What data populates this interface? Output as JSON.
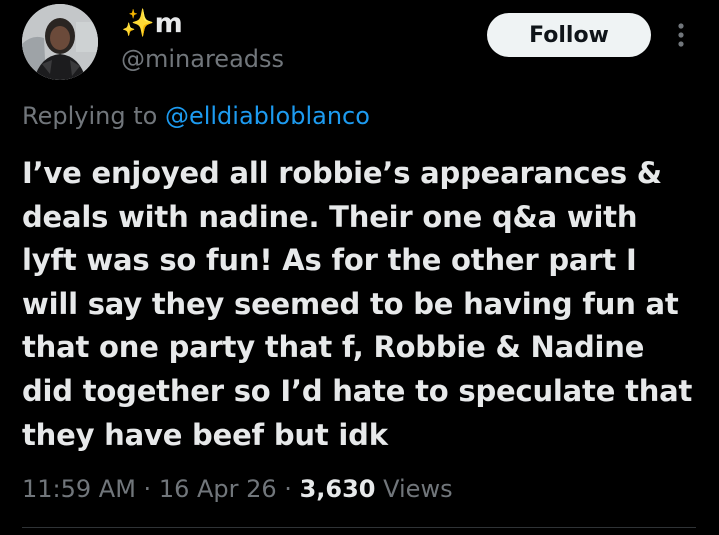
{
  "author": {
    "display_name": "✨m",
    "username": "@minareadss"
  },
  "follow_button": {
    "label": "Follow"
  },
  "more_icon": "more-vertical-icon",
  "reply": {
    "prefix": "Replying to ",
    "handle": "@elldiabloblanco"
  },
  "tweet": {
    "lines": [
      "I’ve enjoyed all robbie’s appearances &",
      "deals with nadine. Their one q&a with",
      "lyft was so fun! As for the other part I",
      "will say they seemed to be having fun at",
      "that one party that f, Robbie & Nadine",
      "did together so I’d hate to speculate that",
      "they have beef but idk"
    ]
  },
  "meta": {
    "time": "11:59 AM",
    "separator": " · ",
    "date": "16 Apr 26",
    "views_count": "3,630",
    "views_label": " Views"
  },
  "colors": {
    "background": "#000000",
    "text": "#e7e9ea",
    "secondary": "#71767b",
    "link": "#1d9bf0",
    "follow_bg": "#eff3f4",
    "divider": "#2f3336"
  }
}
